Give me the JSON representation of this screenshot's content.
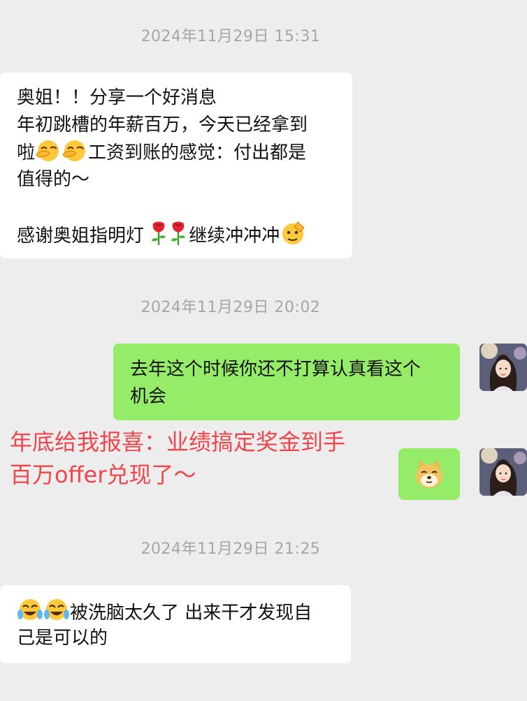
{
  "messages": {
    "t1": "2024年11月29日 15:31",
    "m1_lines": [
      "奥姐！！分享一个好消息",
      "年初跳槽的年薪百万，今天已经拿到",
      "工资到账的感觉：付出都是",
      "值得的～",
      "",
      "感谢奥姐指明灯",
      "继续冲冲冲"
    ],
    "m1_line3_prefix": "啦",
    "t2": "2024年11月29日 20:02",
    "m2_lines": [
      "去年这个时候你还不打算认真看这个",
      "机会"
    ],
    "t3": "2024年11月29日 21:25",
    "m4_line1": "被洗脑太久了 出来干才发现自",
    "m4_line2": "己是可以的"
  },
  "overlay": {
    "line1": "年底给我报喜：业绩搞定奖金到手",
    "line2": "百万offer兑现了～"
  },
  "icons": {
    "finger_emoji": "face-with-finger-icon",
    "rose_emoji": "rose-icon",
    "salute_emoji": "salute-face-icon",
    "dog_emoji": "doge-icon",
    "laugh_emoji": "tears-of-joy-icon",
    "avatar": "user-avatar"
  },
  "colors": {
    "background": "#ededed",
    "incoming_bubble": "#ffffff",
    "outgoing_bubble": "#95ec69",
    "timestamp": "#a6a6a6",
    "overlay_text": "#f0454a"
  }
}
